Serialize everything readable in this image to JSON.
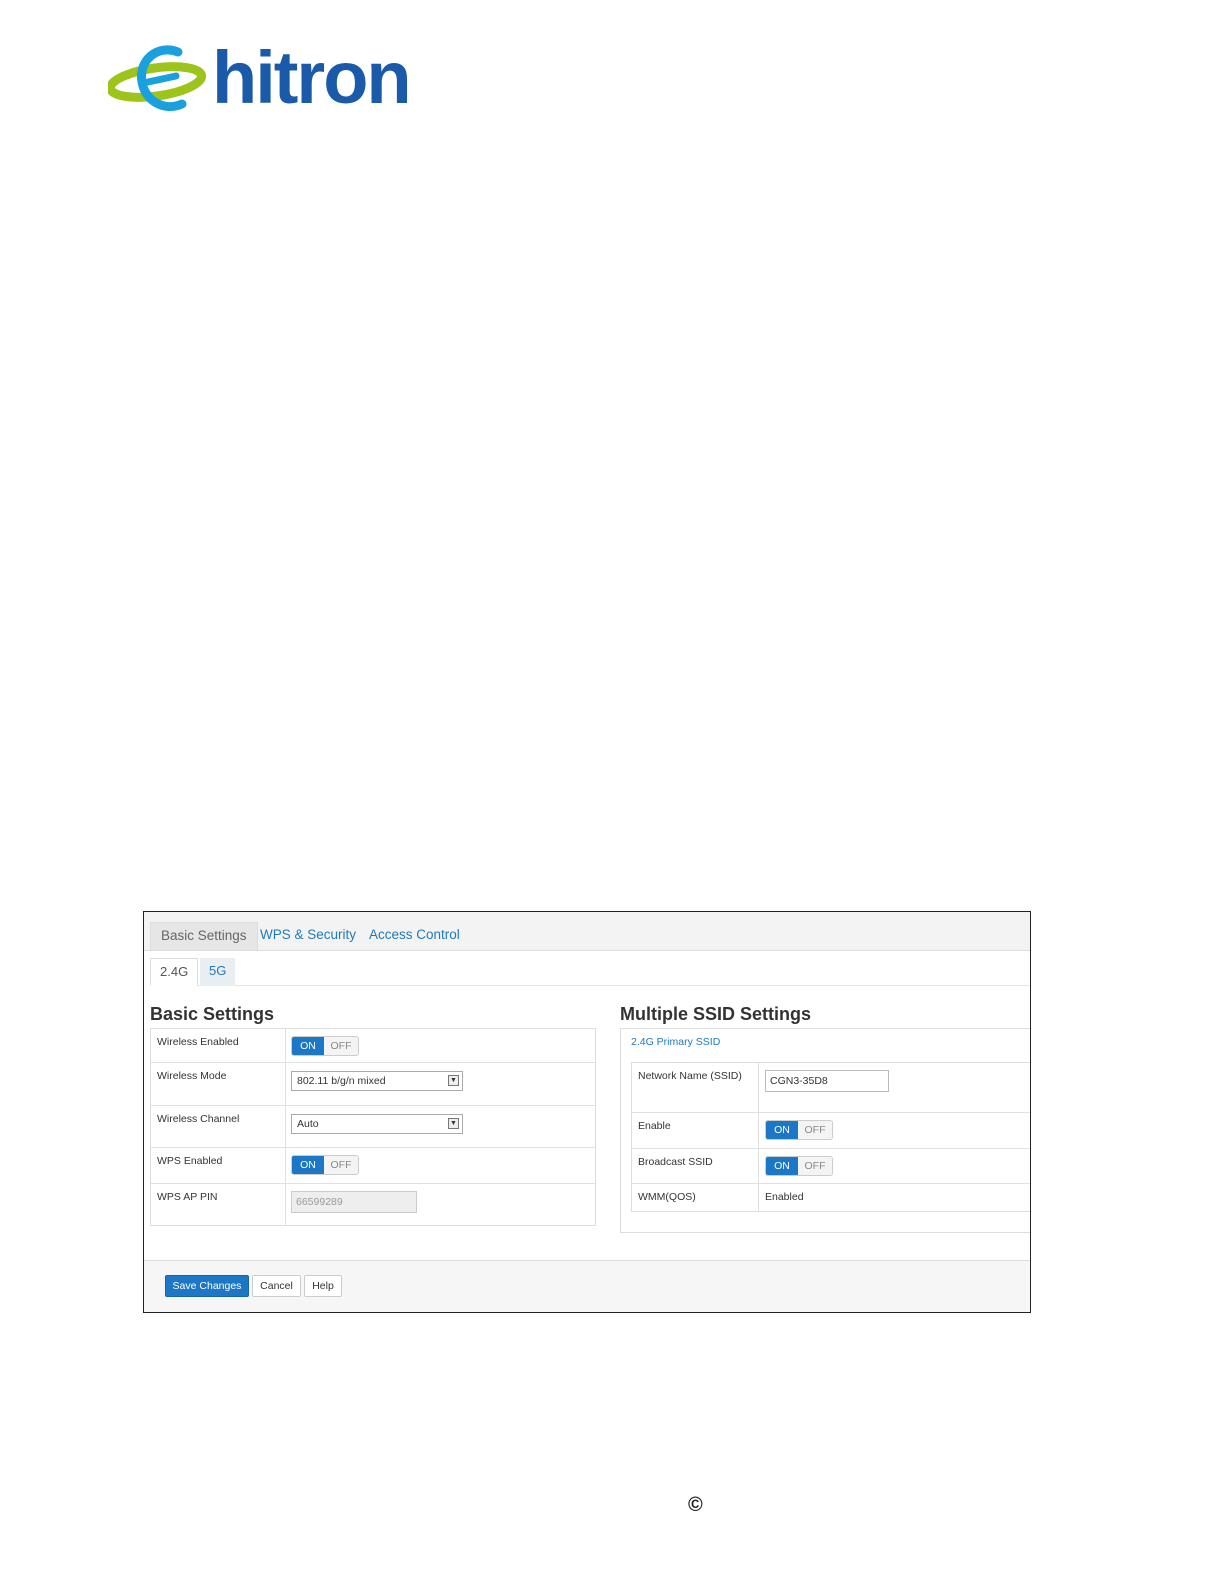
{
  "brand": {
    "logo_text": "hitron",
    "logo_colors": {
      "swoosh": "#9dc41a",
      "letter": "#1a5aa8"
    }
  },
  "main_tabs": [
    {
      "label": "Basic Settings",
      "active": true
    },
    {
      "label": "WPS & Security",
      "active": false
    },
    {
      "label": "Access Control",
      "active": false
    }
  ],
  "band_tabs": [
    {
      "label": "2.4G",
      "active": true
    },
    {
      "label": "5G",
      "active": false
    }
  ],
  "basic_settings": {
    "title": "Basic Settings",
    "wireless_enabled": {
      "label": "Wireless Enabled",
      "on": "ON",
      "off": "OFF",
      "value": "ON"
    },
    "wireless_mode": {
      "label": "Wireless Mode",
      "value": "802.11 b/g/n mixed"
    },
    "wireless_channel": {
      "label": "Wireless Channel",
      "value": "Auto"
    },
    "wps_enabled": {
      "label": "WPS Enabled",
      "on": "ON",
      "off": "OFF",
      "value": "ON"
    },
    "wps_ap_pin": {
      "label": "WPS AP PIN",
      "value": "66599289"
    }
  },
  "multiple_ssid": {
    "title": "Multiple SSID Settings",
    "primary_link": "2.4G Primary SSID",
    "network_name": {
      "label": "Network Name (SSID)",
      "value": "CGN3-35D8"
    },
    "enable": {
      "label": "Enable",
      "on": "ON",
      "off": "OFF",
      "value": "ON"
    },
    "broadcast_ssid": {
      "label": "Broadcast SSID",
      "on": "ON",
      "off": "OFF",
      "value": "ON"
    },
    "wmm": {
      "label": "WMM(QOS)",
      "value": "Enabled"
    }
  },
  "actions": {
    "save": "Save Changes",
    "cancel": "Cancel",
    "help": "Help"
  },
  "copyright_symbol": "©",
  "accent_color": "#1c78c6"
}
